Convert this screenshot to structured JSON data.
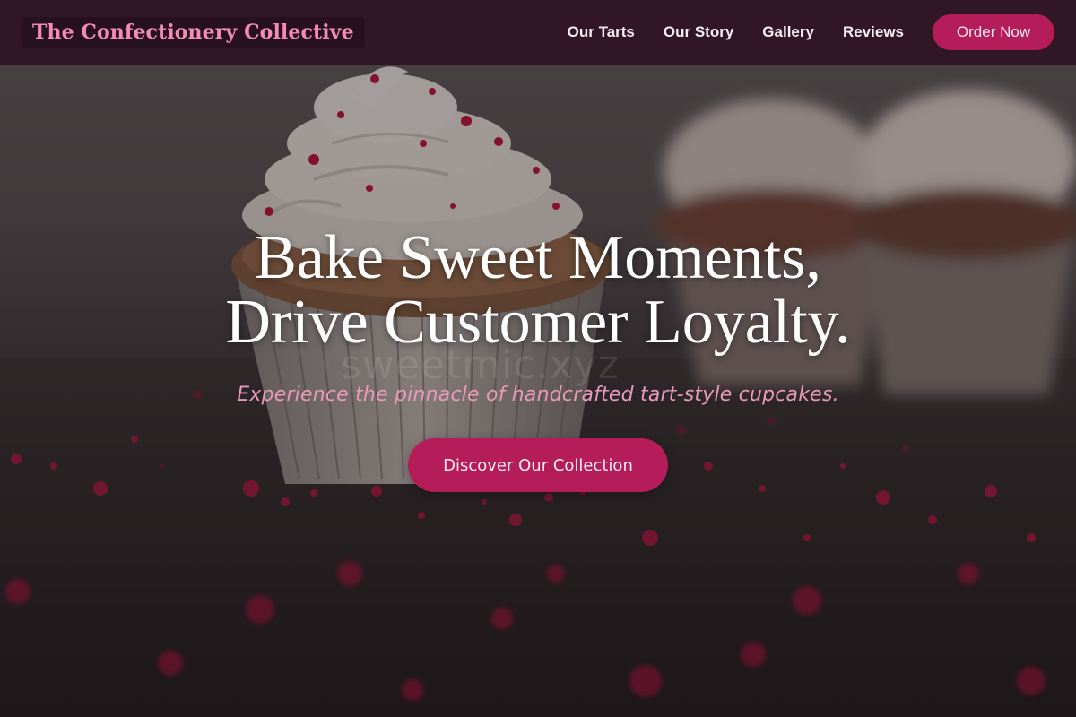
{
  "header": {
    "brand": "The Confectionery Collective",
    "nav": [
      {
        "label": "Our Tarts"
      },
      {
        "label": "Our Story"
      },
      {
        "label": "Gallery"
      },
      {
        "label": "Reviews"
      }
    ],
    "cta_label": "Order Now"
  },
  "hero": {
    "headline_line1": "Bake Sweet Moments,",
    "headline_line2": "Drive Customer Loyalty.",
    "tagline": "Experience the pinnacle of handcrafted tart-style cupcakes.",
    "cta_label": "Discover Our Collection",
    "watermark": "sweetmic.xyz"
  },
  "colors": {
    "accent": "#b51c5a",
    "brand_text": "#f28cb2",
    "tagline": "#e79ab9",
    "header_bg": "#30162a"
  },
  "icons": {
    "hero_image": "cupcake-photo"
  }
}
